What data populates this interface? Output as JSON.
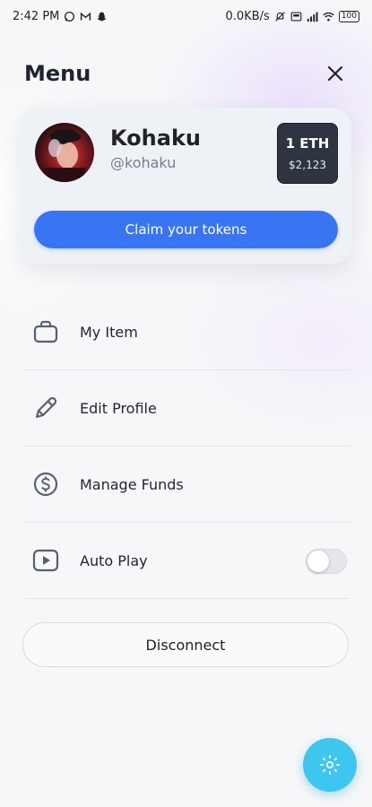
{
  "status_bar": {
    "time": "2:42 PM",
    "net_speed": "0.0KB/s",
    "battery": "100",
    "icons": [
      "whatsapp-icon",
      "gmail-icon",
      "snapchat-icon",
      "mute-icon",
      "volte-icon",
      "signal-icon",
      "wifi-icon",
      "battery-icon"
    ]
  },
  "header": {
    "title": "Menu",
    "close_icon": "close-icon"
  },
  "profile": {
    "name": "Kohaku",
    "handle": "@kohaku",
    "balance_eth": "1 ETH",
    "balance_usd": "$2,123",
    "claim_label": "Claim your tokens",
    "claim_color": "#3975f3"
  },
  "menu": {
    "items": [
      {
        "label": "My Item",
        "icon": "bag-icon"
      },
      {
        "label": "Edit Profile",
        "icon": "pencil-icon"
      },
      {
        "label": "Manage Funds",
        "icon": "dollar-circle-icon"
      },
      {
        "label": "Auto Play",
        "icon": "play-icon",
        "toggle": false
      }
    ]
  },
  "disconnect_label": "Disconnect",
  "fab": {
    "icon": "sun-icon",
    "color": "#3ec6ee"
  }
}
